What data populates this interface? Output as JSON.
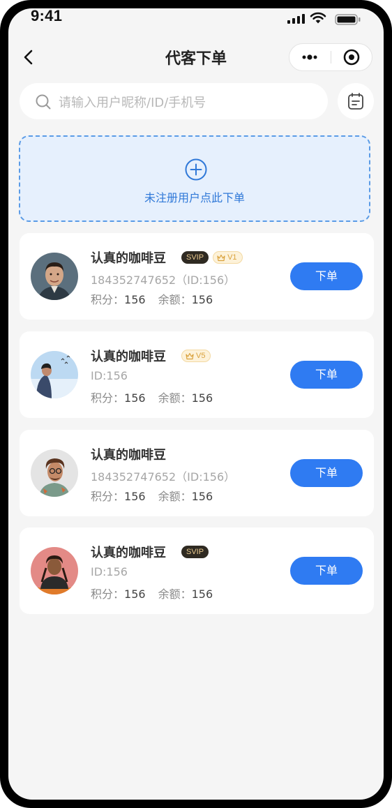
{
  "status_bar": {
    "time": "9:41"
  },
  "nav": {
    "title": "代客下单"
  },
  "search": {
    "placeholder": "请输入用户昵称/ID/手机号"
  },
  "add_unregistered": {
    "label": "未注册用户点此下单"
  },
  "labels": {
    "points": "积分：",
    "balance": "余额：",
    "order_button": "下单"
  },
  "colors": {
    "accent": "#2f7bf2",
    "background": "#f5f5f5",
    "add_box_bg": "#e6f0fd",
    "svip_bg": "#2f2a22",
    "level_text": "#d9a13c"
  },
  "users": [
    {
      "name": "认真的咖啡豆",
      "svip": "SVIP",
      "level": "V1",
      "sub": "184352747652（ID:156）",
      "points": "156",
      "balance": "156"
    },
    {
      "name": "认真的咖啡豆",
      "svip": "",
      "level": "V5",
      "sub": "ID:156",
      "points": "156",
      "balance": "156"
    },
    {
      "name": "认真的咖啡豆",
      "svip": "",
      "level": "",
      "sub": "184352747652（ID:156）",
      "points": "156",
      "balance": "156"
    },
    {
      "name": "认真的咖啡豆",
      "svip": "SVIP",
      "level": "",
      "sub": "ID:156",
      "points": "156",
      "balance": "156"
    }
  ]
}
